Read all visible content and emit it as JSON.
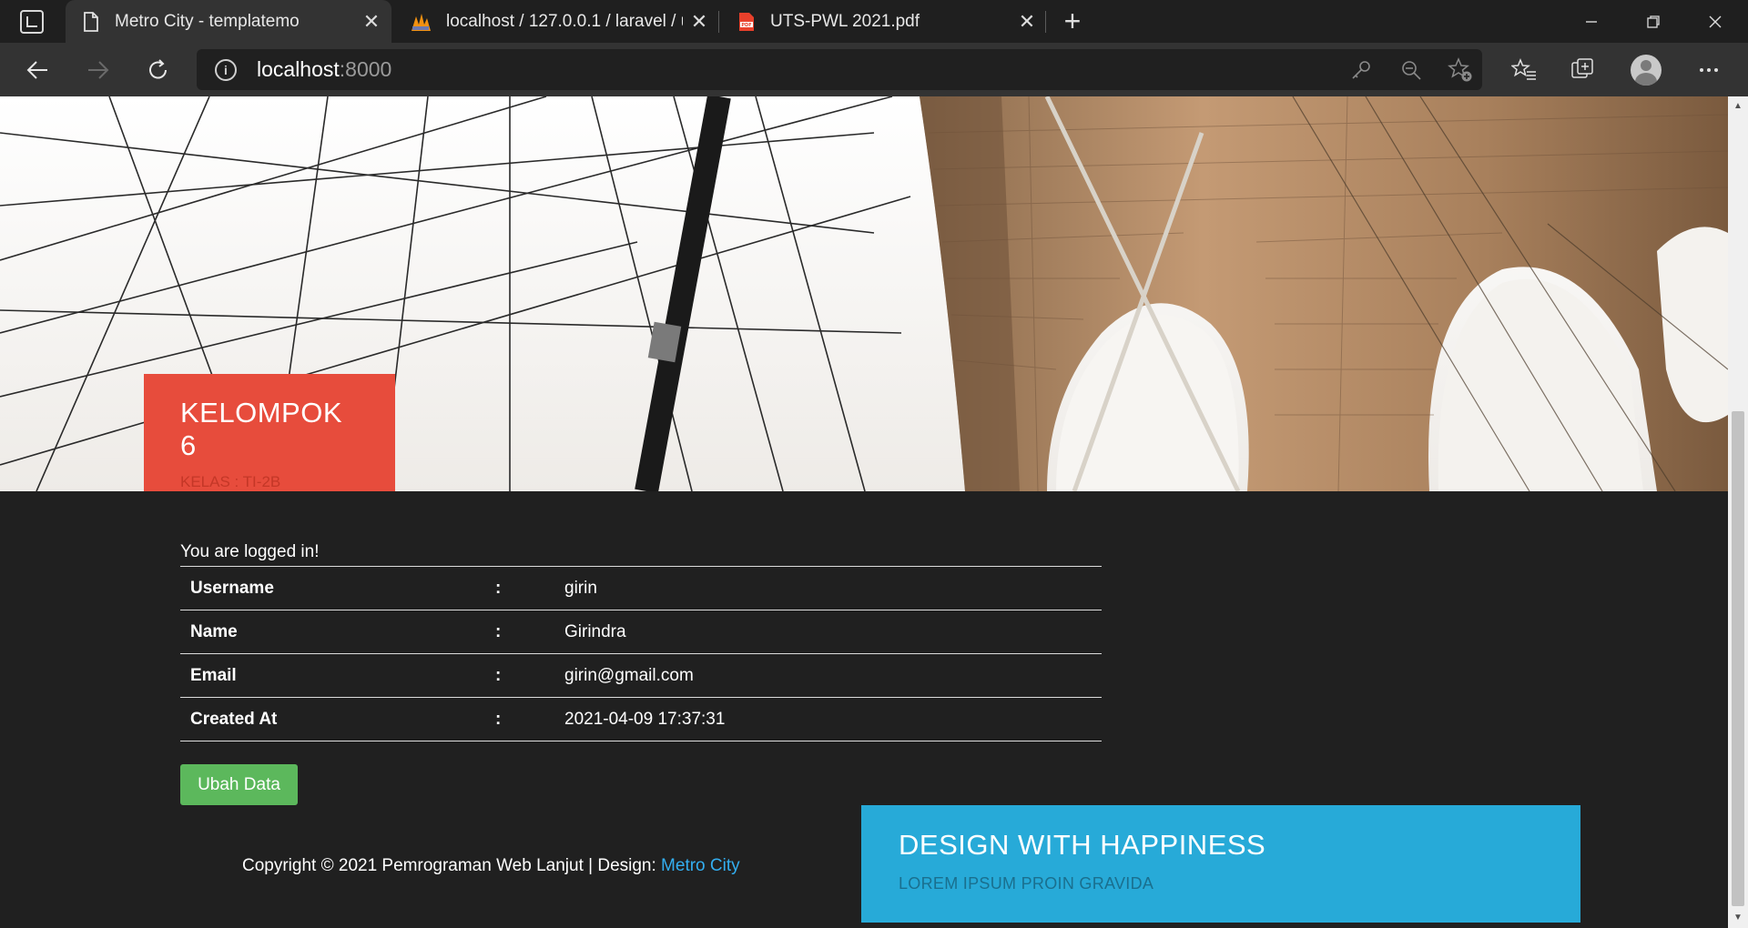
{
  "browser": {
    "tabs": [
      {
        "title": "Metro City - templatemo",
        "icon": "page-icon",
        "active": true
      },
      {
        "title": "localhost / 127.0.0.1 / laravel / us",
        "icon": "phpmyadmin-icon",
        "active": false
      },
      {
        "title": "UTS-PWL 2021.pdf",
        "icon": "pdf-icon",
        "active": false
      }
    ],
    "address": {
      "host": "localhost",
      "port": ":8000"
    }
  },
  "hero": {
    "title": "KELOMPOK 6",
    "subtitle": "KELAS : TI-2B"
  },
  "content": {
    "status": "You are logged in!",
    "rows": [
      {
        "label": "Username",
        "sep": ":",
        "value": "girin"
      },
      {
        "label": "Name",
        "sep": ":",
        "value": "Girindra"
      },
      {
        "label": "Email",
        "sep": ":",
        "value": "girin@gmail.com"
      },
      {
        "label": "Created At",
        "sep": ":",
        "value": "2021-04-09 17:37:31"
      }
    ],
    "edit_button": "Ubah Data"
  },
  "footer": {
    "copyright_text": "Copyright © 2021 Pemrograman Web Lanjut | Design: ",
    "design_link": "Metro City"
  },
  "promo": {
    "title": "DESIGN WITH HAPPINESS",
    "subtitle": "LOREM IPSUM PROIN GRAVIDA"
  },
  "colors": {
    "red_card": "#e74c3c",
    "blue_card": "#27aad8",
    "button_green": "#5cb85c",
    "link": "#33aef0",
    "page_bg": "#202020"
  }
}
